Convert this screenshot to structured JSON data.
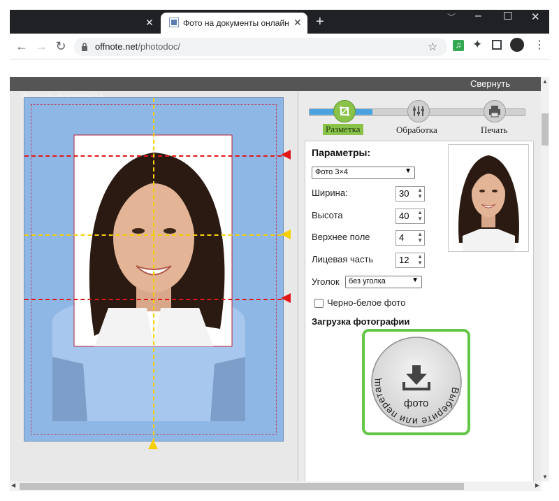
{
  "browser": {
    "tabs": [
      {
        "label": ""
      },
      {
        "label": "Фото на документы онлайн"
      }
    ],
    "new_tab": "+",
    "url_host": "offnote.net",
    "url_path": "/photodoc/",
    "window_controls": {
      "minimize": "–",
      "maximize": "☐",
      "close": "✕"
    }
  },
  "page": {
    "collapse_label": "Свернуть",
    "faded_title": "Фото на документы",
    "steps": [
      {
        "label": "Разметка"
      },
      {
        "label": "Обработка"
      },
      {
        "label": "Печать"
      }
    ],
    "params": {
      "title": "Параметры:",
      "format_select": "Фото 3×4",
      "fields": [
        {
          "label": "Ширина:",
          "value": "30"
        },
        {
          "label": "Высота",
          "value": "40"
        },
        {
          "label": "Верхнее поле",
          "value": "4"
        },
        {
          "label": "Лицевая часть",
          "value": "12"
        }
      ],
      "corner_label": "Уголок",
      "corner_select": "без уголка",
      "bw_label": "Черно-белое фото"
    },
    "upload": {
      "title": "Загрузка фотографии",
      "circle_text": "Выберите или перетащите сюда",
      "photo_word": "фото"
    }
  },
  "colors": {
    "accent": "#8bc34a",
    "progress": "#4aa3df",
    "guide_red": "#e01818",
    "guide_yellow": "#f5cf00",
    "upload_border": "#62c746"
  }
}
